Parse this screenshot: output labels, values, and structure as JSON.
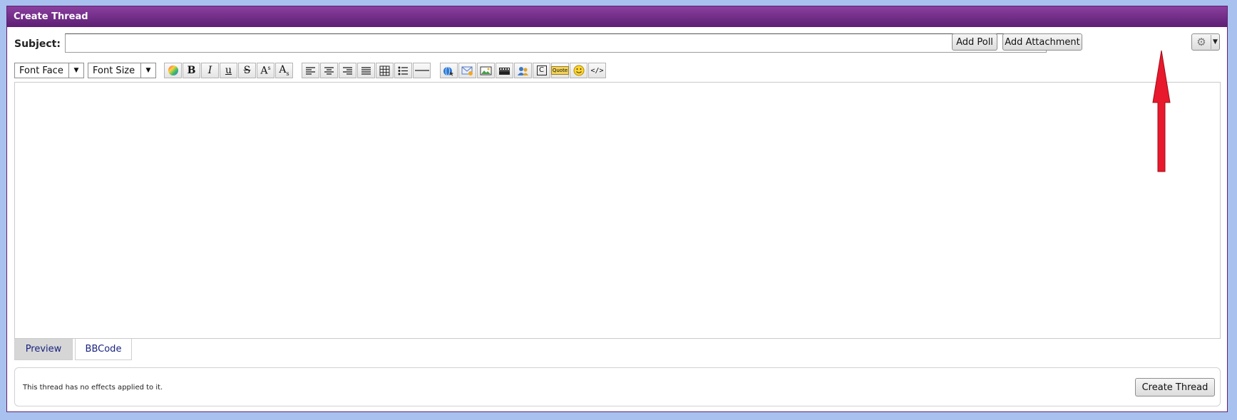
{
  "window": {
    "title": "Create Thread"
  },
  "subject": {
    "label": "Subject:",
    "value": "",
    "placeholder": ""
  },
  "buttons": {
    "add_poll": "Add Poll",
    "add_attachment": "Add Attachment",
    "create_thread": "Create Thread"
  },
  "settings": {
    "icon": "gear-icon",
    "caret_icon": "caret-down-icon"
  },
  "toolbar": {
    "font_face": "Font Face",
    "font_size": "Font Size",
    "buttons": [
      {
        "icon": "color-picker-icon"
      },
      {
        "icon": "bold-icon",
        "glyph": "B"
      },
      {
        "icon": "italic-icon",
        "glyph": "I"
      },
      {
        "icon": "underline-icon",
        "glyph": "u"
      },
      {
        "icon": "strikethrough-icon",
        "glyph": "S"
      },
      {
        "icon": "superscript-icon",
        "glyph": "A",
        "sub": "s"
      },
      {
        "icon": "subscript-icon",
        "glyph": "A",
        "sub": "s"
      },
      {
        "icon": "align-left-icon"
      },
      {
        "icon": "align-center-icon"
      },
      {
        "icon": "align-right-icon"
      },
      {
        "icon": "justify-icon"
      },
      {
        "icon": "table-icon"
      },
      {
        "icon": "bullet-list-icon"
      },
      {
        "icon": "horizontal-rule-icon"
      },
      {
        "icon": "link-icon"
      },
      {
        "icon": "email-icon"
      },
      {
        "icon": "image-icon"
      },
      {
        "icon": "video-icon"
      },
      {
        "icon": "users-icon"
      },
      {
        "icon": "code-c-icon",
        "glyph": "C"
      },
      {
        "icon": "quote-icon",
        "glyph": "Quote"
      },
      {
        "icon": "smiley-icon"
      },
      {
        "icon": "source-code-icon",
        "glyph": "</>"
      }
    ]
  },
  "tabs": {
    "preview": "Preview",
    "bbcode": "BBCode"
  },
  "footer": {
    "effects_text": "This thread has no effects applied to it."
  },
  "colors": {
    "titlebar": "#6b2a82",
    "background": "#a9c1ee",
    "annotation_arrow": "#e8192c",
    "tab_text": "#1a237e"
  }
}
